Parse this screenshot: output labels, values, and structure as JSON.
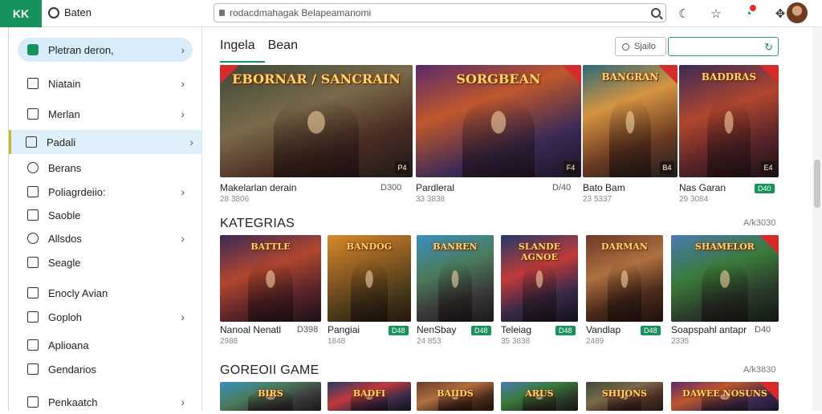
{
  "topbar": {
    "logo": "KK",
    "brand": "Baten",
    "url": "rodacdmahagak Belapeamanomi",
    "icons": [
      "moon-icon",
      "star-icon",
      "notification-icon",
      "puzzle-icon"
    ]
  },
  "sidebar": {
    "items": [
      {
        "label": "Pletran deron,",
        "chevron": true
      },
      {
        "label": "Niatain",
        "chevron": true
      },
      {
        "label": "Merlan",
        "chevron": true
      },
      {
        "label": "Padali",
        "chevron": true
      },
      {
        "label": "Berans",
        "chevron": false
      },
      {
        "label": "Poliagrdeiio:",
        "chevron": true
      },
      {
        "label": "Saoble",
        "chevron": false
      },
      {
        "label": "Allsdos",
        "chevron": true
      },
      {
        "label": "Seagle",
        "chevron": false
      },
      {
        "label": "Enocly Avian",
        "chevron": false
      },
      {
        "label": "Goploh",
        "chevron": true
      },
      {
        "label": "Aplioana",
        "chevron": false
      },
      {
        "label": "Gendarios",
        "chevron": false
      },
      {
        "label": "Penkaatch",
        "chevron": true
      }
    ]
  },
  "main": {
    "tabs": [
      "Ingela",
      "Bean"
    ],
    "search_label": "Sjailo",
    "featured": [
      {
        "name": "Makelarlan derain",
        "sub": "28 3806",
        "price": "D300",
        "art": "EBORNAR / SANCRAIN",
        "tag": "P4"
      },
      {
        "name": "Pardleral",
        "sub": "33 3838",
        "price": "D/40",
        "art": "SORGBEAN",
        "tag": "F4"
      },
      {
        "name": "Bato Bam",
        "sub": "23 5337",
        "price": "",
        "art": "BANGRAN",
        "tag": "B4"
      },
      {
        "name": "Nas Garan",
        "sub": "29 3084",
        "free": "D40",
        "art": "BADDRAS",
        "tag": "E4"
      }
    ],
    "kategorias": {
      "title": "KATEGRIAS",
      "count": "A/k3030",
      "items": [
        {
          "name": "Nanoal Nenatl",
          "sub": "2988",
          "price": "D398",
          "art": "BATTLE"
        },
        {
          "name": "Pangiai",
          "sub": "1848",
          "free": "D48",
          "art": "BANDOG"
        },
        {
          "name": "NenSbay",
          "sub": "24 853",
          "free": "D48",
          "art": "BANREN"
        },
        {
          "name": "Teleiag",
          "sub": "35 3838",
          "free": "D48",
          "art": "SLANDE AGNOE"
        },
        {
          "name": "Vandlap",
          "sub": "2489",
          "free": "D48",
          "art": "DARMAN"
        },
        {
          "name": "Soapspahl antapr",
          "sub": "2335",
          "price": "D40",
          "art": "SHAMELOR"
        }
      ]
    },
    "gorebol": {
      "title": "GOREOII GAME",
      "count": "A/k3830",
      "items": [
        {
          "art": "BIRS"
        },
        {
          "art": "BADFI"
        },
        {
          "art": "BAIIDS"
        },
        {
          "art": "ARUS"
        },
        {
          "art": "SHIJONS"
        },
        {
          "art": "DAWEE NOSUNS"
        }
      ]
    }
  },
  "colors": {
    "accent": "#15935a",
    "active_bg": "#dff0fa",
    "badge": "#d72a2a"
  }
}
